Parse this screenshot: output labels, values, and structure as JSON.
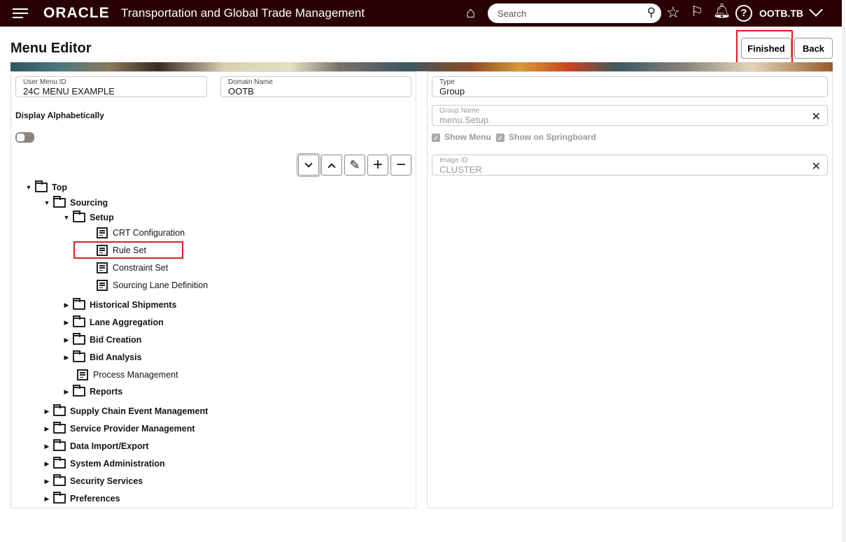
{
  "header": {
    "logo": "ORACLE",
    "app_title": "Transportation and Global Trade Management",
    "search_placeholder": "Search",
    "user": "OOTB.TB",
    "icons": [
      "menu-icon",
      "home-icon",
      "search-icon",
      "star-icon",
      "flag-icon",
      "bell-icon",
      "help-icon",
      "chevron-down-icon"
    ]
  },
  "page": {
    "title": "Menu Editor",
    "finished_label": "Finished",
    "back_label": "Back"
  },
  "left": {
    "user_menu_id": {
      "label": "User Menu ID",
      "value": "24C MENU EXAMPLE"
    },
    "domain_name": {
      "label": "Domain Name",
      "value": "OOTB"
    },
    "display_alpha_label": "Display Alphabetically",
    "display_alpha_on": false,
    "toolbar": [
      "move-down",
      "move-up",
      "edit",
      "add",
      "remove"
    ],
    "tree": [
      {
        "label": "Top",
        "level": 0,
        "type": "folder",
        "state": "expanded"
      },
      {
        "label": "Sourcing",
        "level": 1,
        "type": "folder",
        "state": "expanded"
      },
      {
        "label": "Setup",
        "level": 2,
        "type": "folder",
        "state": "expanded"
      },
      {
        "label": "CRT Configuration",
        "level": 3,
        "type": "item"
      },
      {
        "label": "Rule Set",
        "level": 3,
        "type": "item",
        "highlighted": true
      },
      {
        "label": "Constraint Set",
        "level": 3,
        "type": "item"
      },
      {
        "label": "Sourcing Lane Definition",
        "level": 3,
        "type": "item"
      },
      {
        "label": "Historical Shipments",
        "level": 2,
        "type": "folder",
        "state": "collapsed"
      },
      {
        "label": "Lane Aggregation",
        "level": 2,
        "type": "folder",
        "state": "collapsed"
      },
      {
        "label": "Bid Creation",
        "level": 2,
        "type": "folder",
        "state": "collapsed"
      },
      {
        "label": "Bid Analysis",
        "level": 2,
        "type": "folder",
        "state": "collapsed"
      },
      {
        "label": "Process Management",
        "level": 2,
        "type": "item"
      },
      {
        "label": "Reports",
        "level": 2,
        "type": "folder",
        "state": "collapsed"
      },
      {
        "label": "Supply Chain Event Management",
        "level": 1,
        "type": "folder",
        "state": "collapsed"
      },
      {
        "label": "Service Provider Management",
        "level": 1,
        "type": "folder",
        "state": "collapsed"
      },
      {
        "label": "Data Import/Export",
        "level": 1,
        "type": "folder",
        "state": "collapsed"
      },
      {
        "label": "System Administration",
        "level": 1,
        "type": "folder",
        "state": "collapsed"
      },
      {
        "label": "Security Services",
        "level": 1,
        "type": "folder",
        "state": "collapsed"
      },
      {
        "label": "Preferences",
        "level": 1,
        "type": "folder",
        "state": "collapsed"
      }
    ]
  },
  "right": {
    "type": {
      "label": "Type",
      "value": "Group"
    },
    "group_name": {
      "label": "Group Name",
      "value": "menu.Setup"
    },
    "show_menu": {
      "label": "Show Menu",
      "checked": true
    },
    "show_springboard": {
      "label": "Show on Springboard",
      "checked": true
    },
    "image_id": {
      "label": "Image ID",
      "value": "CLUSTER"
    }
  },
  "colors": {
    "header_bg": "#2a0102",
    "highlight": "#e01b24"
  }
}
